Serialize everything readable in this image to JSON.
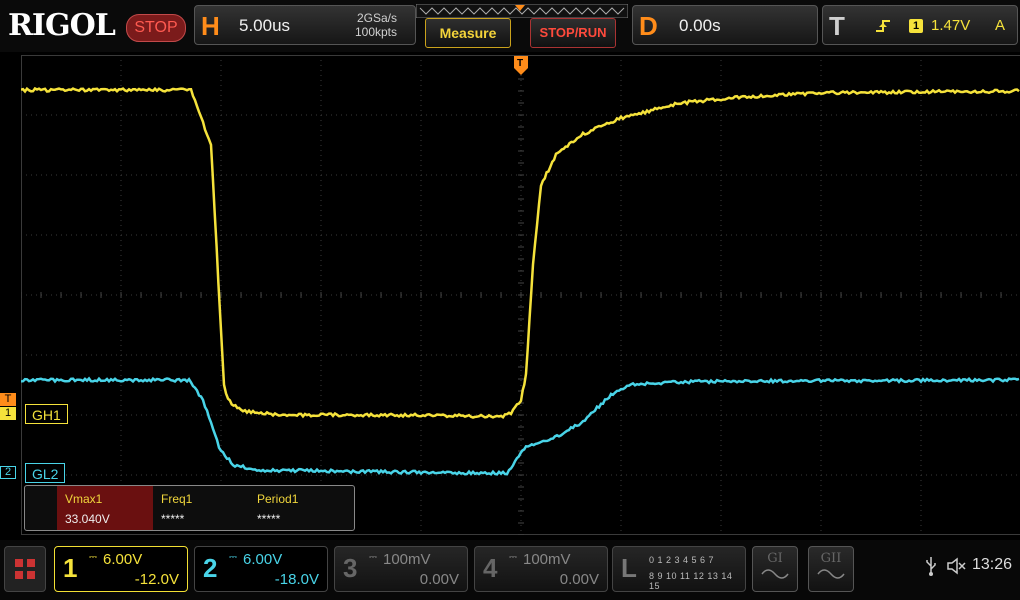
{
  "header": {
    "brand": "RIGOL",
    "run_state": "STOP",
    "horizontal": {
      "letter": "H",
      "timebase": "5.00us",
      "sample_rate": "2GSa/s",
      "memory_depth": "100kpts"
    },
    "measure_button": "Measure",
    "stop_run_button": "STOP/RUN",
    "delay": {
      "letter": "D",
      "value": "0.00s"
    },
    "trigger": {
      "letter": "T",
      "source": "1",
      "level": "1.47V",
      "mode": "A"
    }
  },
  "waveform": {
    "trigger_marker": "T",
    "channels": [
      {
        "id": "1",
        "label": "GH1",
        "color": "#f5e23b"
      },
      {
        "id": "2",
        "label": "GL2",
        "color": "#49d4e8"
      }
    ]
  },
  "measurements": [
    {
      "name": "Vmax1",
      "value": "33.040V"
    },
    {
      "name": "Freq1",
      "value": "*****"
    },
    {
      "name": "Period1",
      "value": "*****"
    }
  ],
  "footer": {
    "channels": [
      {
        "num": "1",
        "scale": "6.00V",
        "offset": "-12.0V"
      },
      {
        "num": "2",
        "scale": "6.00V",
        "offset": "-18.0V"
      },
      {
        "num": "3",
        "scale": "100mV",
        "offset": "0.00V"
      },
      {
        "num": "4",
        "scale": "100mV",
        "offset": "0.00V"
      }
    ],
    "logic": {
      "letter": "L",
      "bits_row1": "0 1 2 3  4 5 6 7",
      "bits_row2": "8 9 10 11 12 13 14 15"
    },
    "g1": "GI",
    "g2": "GII",
    "time": "13:26"
  },
  "colors": {
    "ch1": "#f5e23b",
    "ch2": "#49d4e8",
    "accent": "#ff8c1a",
    "stop": "#ff4a3c"
  }
}
